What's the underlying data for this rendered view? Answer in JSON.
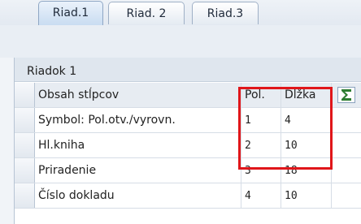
{
  "tabs": [
    {
      "label": "Riad.1"
    },
    {
      "label": "Riad. 2"
    },
    {
      "label": "Riad.3"
    }
  ],
  "active_tab": "Riad.1",
  "section": {
    "title": "Riadok 1"
  },
  "table": {
    "columns": [
      "Obsah stĺpcov",
      "Pol.",
      "Dĺžka"
    ],
    "rows": [
      {
        "content": "Symbol: Pol.otv./vyrovn.",
        "pos": "1",
        "len": "4"
      },
      {
        "content": "Hl.kniha",
        "pos": "2",
        "len": "10"
      },
      {
        "content": "Priradenie",
        "pos": "3",
        "len": "18"
      },
      {
        "content": "Číslo dokladu",
        "pos": "4",
        "len": "10"
      }
    ]
  },
  "toolbar": {
    "sum_icon": "sigma-sum-icon"
  },
  "colors": {
    "highlight": "#e0161a",
    "sum_icon": "#2e7d32"
  }
}
